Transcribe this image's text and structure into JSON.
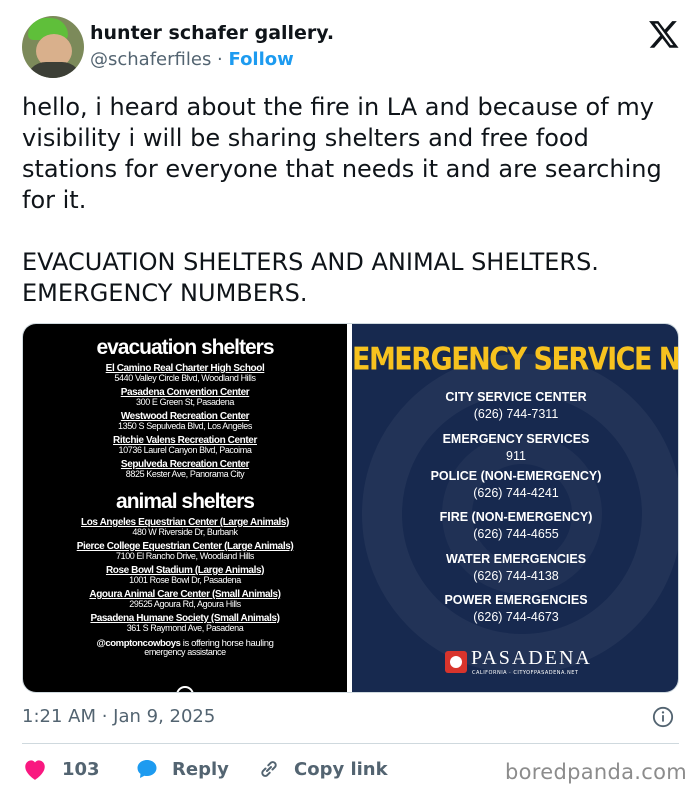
{
  "author": {
    "name": "hunter schafer gallery.",
    "handle": "@schaferfiles",
    "separator": " · ",
    "follow_label": "Follow"
  },
  "tweet": {
    "paragraphs": [
      "hello, i heard about the fire in LA and because of my visibility i will be sharing shelters and free food stations for everyone that needs it and are searching for it.",
      "EVACUATION SHELTERS AND ANIMAL SHELTERS. EMERGENCY NUMBERS."
    ]
  },
  "image_left": {
    "evacuation_heading": "evacuation shelters",
    "evacuation": [
      {
        "title": "El Camino Real Charter High School",
        "address": "5440 Valley Circle Blvd, Woodland Hills"
      },
      {
        "title": "Pasadena Convention Center",
        "address": "300 E Green St, Pasadena"
      },
      {
        "title": "Westwood Recreation Center",
        "address": "1350 S Sepulveda Blvd, Los Angeles"
      },
      {
        "title": "Ritchie Valens Recreation Center",
        "address": "10736 Laurel Canyon Blvd, Pacoima"
      },
      {
        "title": "Sepulveda Recreation Center",
        "address": "8825 Kester Ave, Panorama City"
      }
    ],
    "animal_heading": "animal shelters",
    "animal": [
      {
        "title": "Los Angeles Equestrian Center (Large Animals)",
        "address": "480 W Riverside Dr, Burbank"
      },
      {
        "title": "Pierce College Equestrian Center (Large Animals)",
        "address": "7100 El Rancho Drive, Woodland Hills"
      },
      {
        "title": "Rose Bowl Stadium (Large Animals)",
        "address": "1001 Rose Bowl Dr, Pasadena"
      },
      {
        "title": "Agoura Animal Care Center (Small Animals)",
        "address": "29525 Agoura Rd, Agoura Hills"
      },
      {
        "title": "Pasadena Humane Society (Small Animals)",
        "address": "361 S Raymond Ave, Pasadena"
      }
    ],
    "note_handle": "@comptoncowboys",
    "note_text": " is offering horse hauling",
    "note_text2": "emergency assistance"
  },
  "image_right": {
    "banner": "EMERGENCY SERVICE NUMBERS",
    "services": [
      {
        "label": "CITY SERVICE CENTER",
        "number": "(626) 744-7311"
      },
      {
        "label": "EMERGENCY SERVICES",
        "number": "911"
      },
      {
        "label": "POLICE (NON-EMERGENCY)",
        "number": "(626) 744-4241"
      },
      {
        "label": "FIRE (NON-EMERGENCY)",
        "number": "(626) 744-4655"
      },
      {
        "label": "WATER EMERGENCIES",
        "number": "(626) 744-4138"
      },
      {
        "label": "POWER EMERGENCIES",
        "number": "(626) 744-4673"
      }
    ],
    "logo_word": "PASADENA",
    "logo_sub": "CALIFORNIA · CITYOFPASADENA.NET"
  },
  "meta": {
    "timestamp": "1:21 AM · Jan 9, 2025"
  },
  "actions": {
    "like_count": "103",
    "reply_label": "Reply",
    "copy_label": "Copy link"
  },
  "watermark": "boredpanda.com",
  "colors": {
    "accent": "#1d9bf0",
    "like": "#f91880",
    "banner_yellow": "#f7c21f",
    "panel_navy": "#17294f"
  }
}
